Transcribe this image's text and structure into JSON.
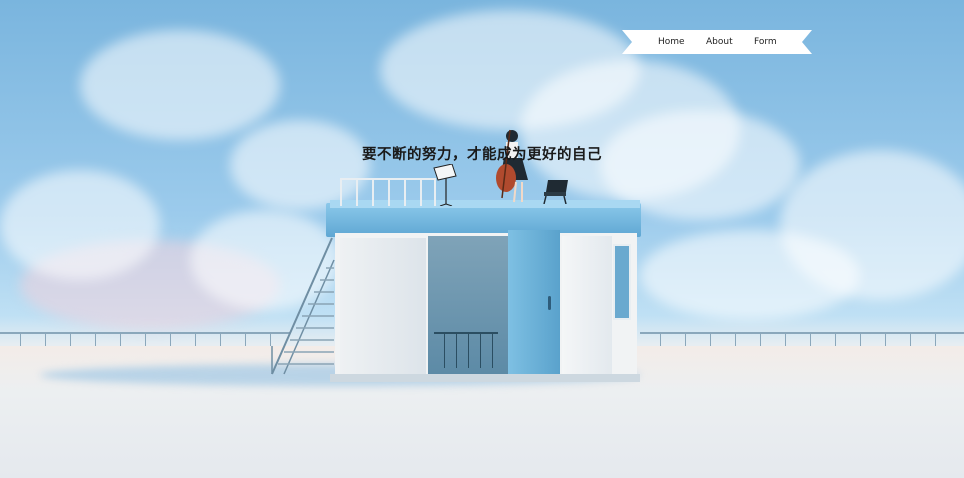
{
  "nav": {
    "items": [
      {
        "label": "Home"
      },
      {
        "label": "About"
      },
      {
        "label": "Form"
      }
    ]
  },
  "hero": {
    "headline": "要不断的努力，才能成为更好的自己"
  },
  "colors": {
    "sky": "#7ab5de",
    "ribbon": "#ffffff",
    "headline": "#1a1a1a"
  }
}
